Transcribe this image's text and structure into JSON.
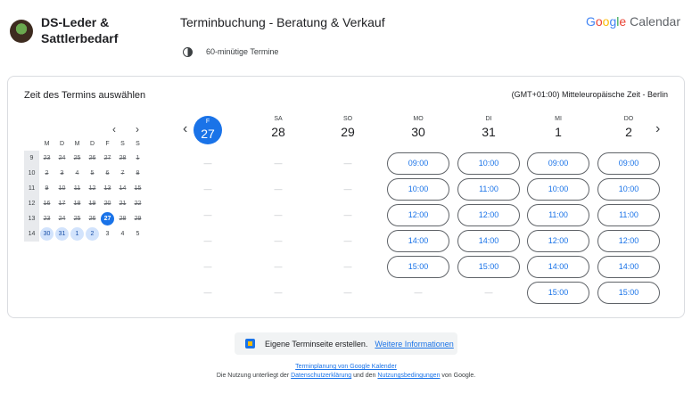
{
  "header": {
    "brand_line1": "DS-Leder &",
    "brand_line2": "Sattlerbedarf",
    "title": "Terminbuchung - Beratung & Verkauf",
    "duration": "60-minütige Termine",
    "google": [
      "G",
      "o",
      "o",
      "g",
      "l",
      "e"
    ],
    "calendar": "Calendar"
  },
  "panel": {
    "title": "Zeit des Termins auswählen",
    "timezone": "(GMT+01:00) Mitteleuropäische Zeit - Berlin"
  },
  "mini_calendar": {
    "prev": "‹",
    "next": "›",
    "weekdays": [
      "M",
      "D",
      "M",
      "D",
      "F",
      "S",
      "S"
    ],
    "weeks": [
      {
        "wk": "9",
        "days": [
          "23",
          "24",
          "25",
          "26",
          "27",
          "28",
          "1"
        ]
      },
      {
        "wk": "10",
        "days": [
          "2",
          "3",
          "4",
          "5",
          "6",
          "7",
          "8"
        ]
      },
      {
        "wk": "11",
        "days": [
          "9",
          "10",
          "11",
          "12",
          "13",
          "14",
          "15"
        ]
      },
      {
        "wk": "12",
        "days": [
          "16",
          "17",
          "18",
          "19",
          "20",
          "21",
          "22"
        ]
      },
      {
        "wk": "13",
        "days": [
          "23",
          "24",
          "25",
          "26",
          "27",
          "28",
          "29"
        ]
      },
      {
        "wk": "14",
        "days": [
          "30",
          "31",
          "1",
          "2",
          "3",
          "4",
          "5"
        ]
      }
    ]
  },
  "week": {
    "prev": "‹",
    "next": "›",
    "days": [
      {
        "dow": "F",
        "dom": "27",
        "slots": []
      },
      {
        "dow": "SA",
        "dom": "28",
        "slots": []
      },
      {
        "dow": "SO",
        "dom": "29",
        "slots": []
      },
      {
        "dow": "MO",
        "dom": "30",
        "slots": [
          "09:00",
          "10:00",
          "12:00",
          "14:00",
          "15:00"
        ]
      },
      {
        "dow": "DI",
        "dom": "31",
        "slots": [
          "10:00",
          "11:00",
          "12:00",
          "14:00",
          "15:00"
        ]
      },
      {
        "dow": "MI",
        "dom": "1",
        "slots": [
          "09:00",
          "10:00",
          "11:00",
          "12:00",
          "14:00",
          "15:00"
        ]
      },
      {
        "dow": "DO",
        "dom": "2",
        "slots": [
          "09:00",
          "10:00",
          "11:00",
          "12:00",
          "14:00",
          "15:00"
        ]
      }
    ],
    "empty_marker": "—"
  },
  "footer": {
    "promo_text": "Eigene Terminseite erstellen.",
    "promo_link": "Weitere Informationen",
    "line1_link": "Terminplanung von Google Kalender",
    "line2_a": "Die Nutzung unterliegt der ",
    "privacy": "Datenschutzerklärung",
    "line2_b": " und den ",
    "terms": "Nutzungsbedingungen",
    "line2_c": " von Google."
  }
}
